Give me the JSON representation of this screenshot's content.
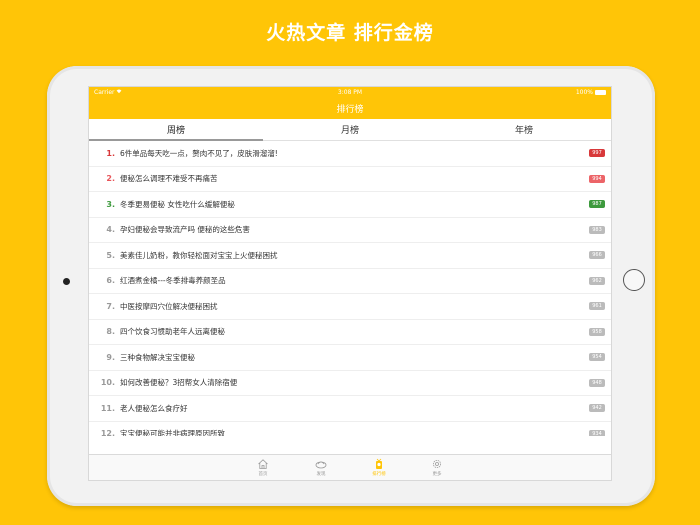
{
  "promo": {
    "title": "火热文章 排行金榜"
  },
  "statusbar": {
    "carrier": "Carrier ",
    "time": "3:08 PM",
    "battery": "100%"
  },
  "navbar": {
    "title": "排行榜"
  },
  "tabs": [
    {
      "label": "周榜",
      "active": true
    },
    {
      "label": "月榜",
      "active": false
    },
    {
      "label": "年榜",
      "active": false
    }
  ],
  "ranking": [
    {
      "rank": "1.",
      "title": "6件单品每天吃一点，赘肉不见了，皮肤滑溜溜!",
      "count": "997",
      "rank_color": "#D8383A",
      "badge_color": "#D8383A"
    },
    {
      "rank": "2.",
      "title": "便秘怎么调理不难受不再痛苦",
      "count": "994",
      "rank_color": "#E8555A",
      "badge_color": "#EC6468"
    },
    {
      "rank": "3.",
      "title": "冬季更易便秘 女性吃什么缓解便秘",
      "count": "987",
      "rank_color": "#3D9A3D",
      "badge_color": "#3D9A3D"
    },
    {
      "rank": "4.",
      "title": "孕妇便秘会导致流产吗 便秘的这些危害",
      "count": "983",
      "rank_color": "#999999",
      "badge_color": "#BBBBBB"
    },
    {
      "rank": "5.",
      "title": "美素佳儿奶粉，教你轻松面对宝宝上火便秘困扰",
      "count": "966",
      "rank_color": "#999999",
      "badge_color": "#BBBBBB"
    },
    {
      "rank": "6.",
      "title": "红酒煮金橘---冬季排毒养颜圣品",
      "count": "962",
      "rank_color": "#999999",
      "badge_color": "#BBBBBB"
    },
    {
      "rank": "7.",
      "title": "中医按摩四穴位解决便秘困扰",
      "count": "961",
      "rank_color": "#999999",
      "badge_color": "#BBBBBB"
    },
    {
      "rank": "8.",
      "title": "四个饮食习惯助老年人远离便秘",
      "count": "958",
      "rank_color": "#999999",
      "badge_color": "#BBBBBB"
    },
    {
      "rank": "9.",
      "title": "三种食物解决宝宝便秘",
      "count": "954",
      "rank_color": "#999999",
      "badge_color": "#BBBBBB"
    },
    {
      "rank": "10.",
      "title": "如何改善便秘？3招帮女人清除宿便",
      "count": "948",
      "rank_color": "#999999",
      "badge_color": "#BBBBBB"
    },
    {
      "rank": "11.",
      "title": "老人便秘怎么食疗好",
      "count": "942",
      "rank_color": "#999999",
      "badge_color": "#BBBBBB"
    },
    {
      "rank": "12.",
      "title": "宝宝便秘可能并非病理原因所致",
      "count": "934",
      "rank_color": "#999999",
      "badge_color": "#BBBBBB"
    }
  ],
  "tabbar": [
    {
      "label": "首页",
      "icon": "home-icon",
      "active": false
    },
    {
      "label": "发现",
      "icon": "discover-icon",
      "active": false
    },
    {
      "label": "排行榜",
      "icon": "ranking-icon",
      "active": true
    },
    {
      "label": "更多",
      "icon": "gear-icon",
      "active": false
    }
  ],
  "colors": {
    "brand": "#FFC507"
  }
}
